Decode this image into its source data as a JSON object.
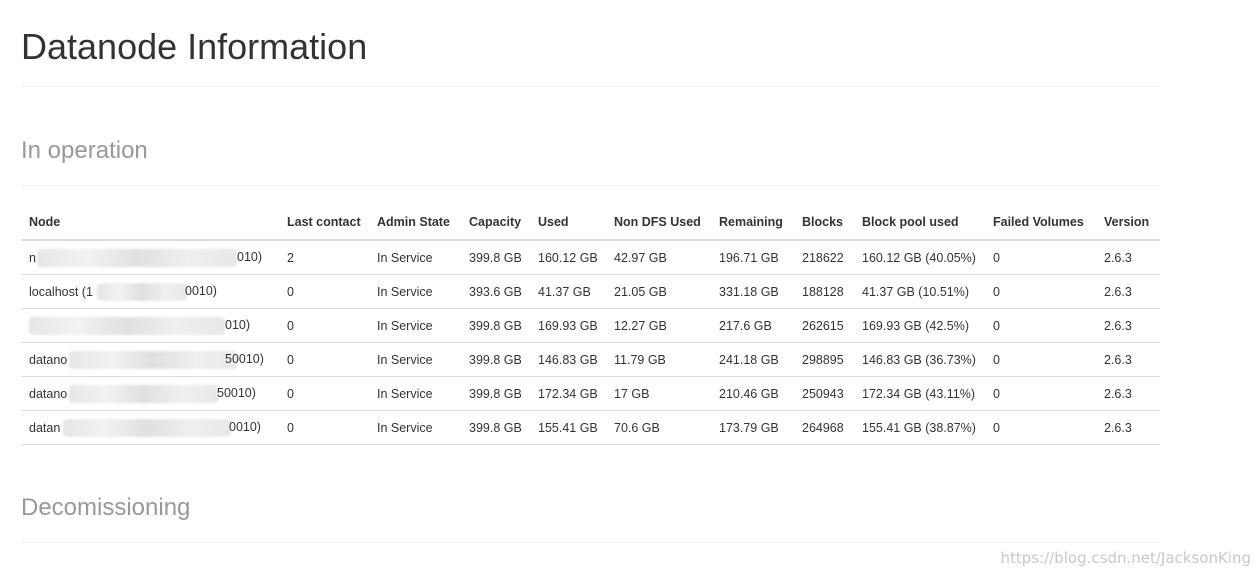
{
  "page": {
    "title": "Datanode Information"
  },
  "sections": {
    "in_operation": "In operation",
    "decommissioning": "Decomissioning"
  },
  "table": {
    "headers": [
      "Node",
      "Last contact",
      "Admin State",
      "Capacity",
      "Used",
      "Non DFS Used",
      "Remaining",
      "Blocks",
      "Block pool used",
      "Failed Volumes",
      "Version"
    ],
    "rows": [
      {
        "node_prefix": "n",
        "node_suffix": "010)",
        "last_contact": "2",
        "admin_state": "In Service",
        "capacity": "399.8 GB",
        "used": "160.12 GB",
        "non_dfs_used": "42.97 GB",
        "remaining": "196.71 GB",
        "blocks": "218622",
        "block_pool_used": "160.12 GB (40.05%)",
        "failed_volumes": "0",
        "version": "2.6.3"
      },
      {
        "node_prefix": "localhost (1",
        "node_suffix": "0010)",
        "last_contact": "0",
        "admin_state": "In Service",
        "capacity": "393.6 GB",
        "used": "41.37 GB",
        "non_dfs_used": "21.05 GB",
        "remaining": "331.18 GB",
        "blocks": "188128",
        "block_pool_used": "41.37 GB (10.51%)",
        "failed_volumes": "0",
        "version": "2.6.3"
      },
      {
        "node_prefix": "",
        "node_suffix": "010)",
        "last_contact": "0",
        "admin_state": "In Service",
        "capacity": "399.8 GB",
        "used": "169.93 GB",
        "non_dfs_used": "12.27 GB",
        "remaining": "217.6 GB",
        "blocks": "262615",
        "block_pool_used": "169.93 GB (42.5%)",
        "failed_volumes": "0",
        "version": "2.6.3"
      },
      {
        "node_prefix": "datano",
        "node_suffix": "50010)",
        "last_contact": "0",
        "admin_state": "In Service",
        "capacity": "399.8 GB",
        "used": "146.83 GB",
        "non_dfs_used": "11.79 GB",
        "remaining": "241.18 GB",
        "blocks": "298895",
        "block_pool_used": "146.83 GB (36.73%)",
        "failed_volumes": "0",
        "version": "2.6.3"
      },
      {
        "node_prefix": "datano",
        "node_suffix": "50010)",
        "last_contact": "0",
        "admin_state": "In Service",
        "capacity": "399.8 GB",
        "used": "172.34 GB",
        "non_dfs_used": "17 GB",
        "remaining": "210.46 GB",
        "blocks": "250943",
        "block_pool_used": "172.34 GB (43.11%)",
        "failed_volumes": "0",
        "version": "2.6.3"
      },
      {
        "node_prefix": "datan",
        "node_suffix": "0010)",
        "last_contact": "0",
        "admin_state": "In Service",
        "capacity": "399.8 GB",
        "used": "155.41 GB",
        "non_dfs_used": "70.6 GB",
        "remaining": "173.79 GB",
        "blocks": "264968",
        "block_pool_used": "155.41 GB (38.87%)",
        "failed_volumes": "0",
        "version": "2.6.3"
      }
    ]
  },
  "watermark": "https://blog.csdn.net/JacksonKing"
}
